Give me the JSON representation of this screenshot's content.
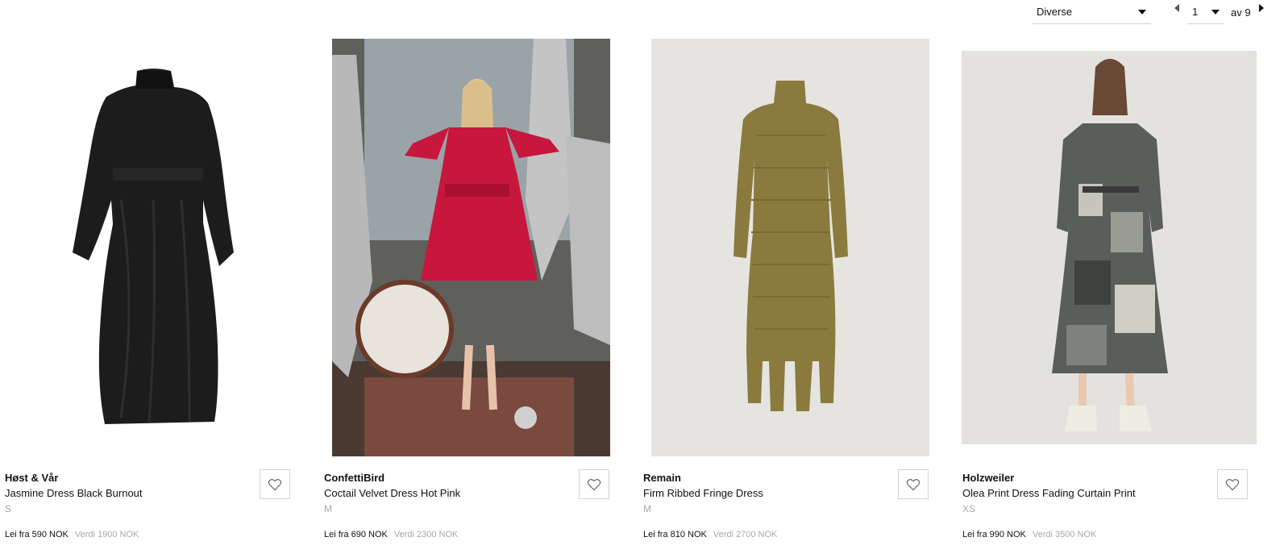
{
  "toolbar": {
    "sort_label": "Diverse",
    "page_current": "1",
    "page_of": "av 9"
  },
  "products": [
    {
      "brand": "Høst & Vår",
      "name": "Jasmine Dress Black Burnout",
      "size": "S",
      "rent": "Lei fra 590 NOK",
      "value": "Verdi 1900 NOK"
    },
    {
      "brand": "ConfettiBird",
      "name": "Coctail Velvet Dress Hot Pink",
      "size": "M",
      "rent": "Lei fra 690 NOK",
      "value": "Verdi 2300 NOK"
    },
    {
      "brand": "Remain",
      "name": "Firm Ribbed Fringe Dress",
      "size": "M",
      "rent": "Lei fra 810 NOK",
      "value": "Verdi 2700 NOK"
    },
    {
      "brand": "Holzweiler",
      "name": "Olea Print Dress Fading Curtain Print",
      "size": "XS",
      "rent": "Lei fra 990 NOK",
      "value": "Verdi 3500 NOK"
    }
  ],
  "colors": {
    "muted_text": "#a8a8a8",
    "border": "#d4d4d4",
    "pink_dress": "#c8173c",
    "olive_dress": "#8a7a3e",
    "image_bg_grey": "#e6e4e0"
  },
  "icons": {
    "favorite": "heart-outline-icon",
    "sort_toggle": "chevron-down-icon",
    "prev_page": "chevron-left-icon",
    "next_page": "chevron-right-icon"
  }
}
